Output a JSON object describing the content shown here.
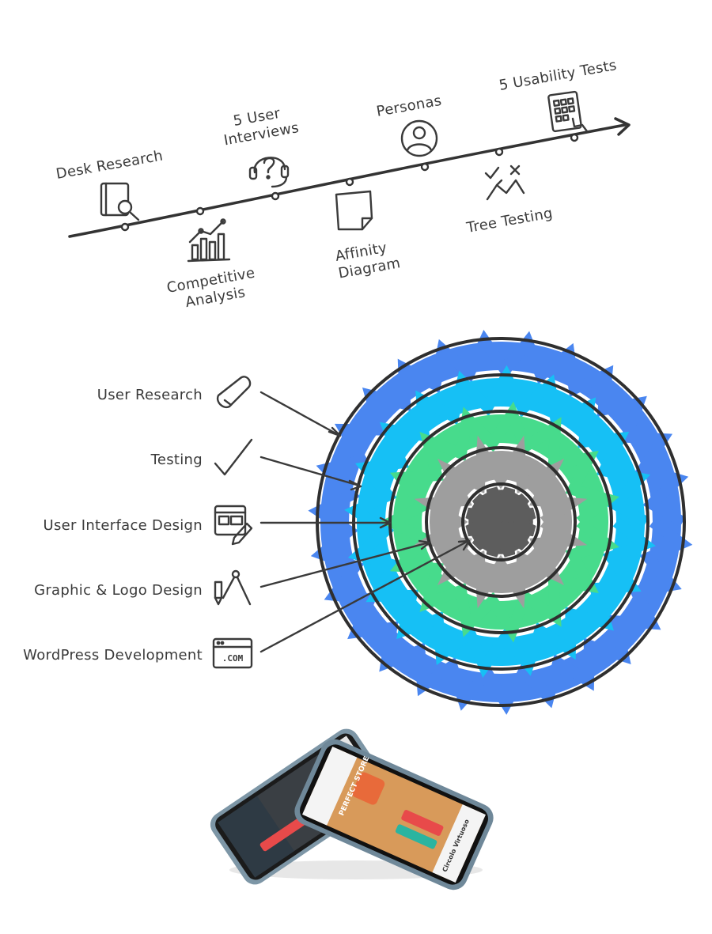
{
  "timeline": {
    "steps": [
      {
        "label": "Desk Research",
        "icon": "book-magnifier-icon"
      },
      {
        "label": "Competitive Analysis",
        "icon": "bar-chart-icon"
      },
      {
        "label": "5 User Interviews",
        "icon": "headset-question-icon"
      },
      {
        "label": "Affinity Diagram",
        "icon": "sticky-note-icon"
      },
      {
        "label": "Personas",
        "icon": "user-circle-icon"
      },
      {
        "label": "Tree Testing",
        "icon": "tree-check-icon"
      },
      {
        "label": "5 Usability Tests",
        "icon": "tablet-tap-icon"
      }
    ]
  },
  "rings": {
    "items": [
      {
        "label": "User Research",
        "icon": "bandage-icon",
        "color": "#4a86f0"
      },
      {
        "label": "Testing",
        "icon": "checkmark-icon",
        "color": "#16c0f5"
      },
      {
        "label": "User Interface Design",
        "icon": "layout-pencil-icon",
        "color": "#47db8c"
      },
      {
        "label": "Graphic & Logo Design",
        "icon": "compass-pen-icon",
        "color": "#9e9e9e"
      },
      {
        "label": "WordPress Development",
        "icon": "browser-com-icon",
        "color": "#5d5d5d"
      }
    ],
    "com_text": ".COM"
  },
  "phones": {
    "front_title": "PERFECT STORE",
    "front_footer": "Circolo Virtuoso",
    "brand_color": "#e84a4a"
  }
}
